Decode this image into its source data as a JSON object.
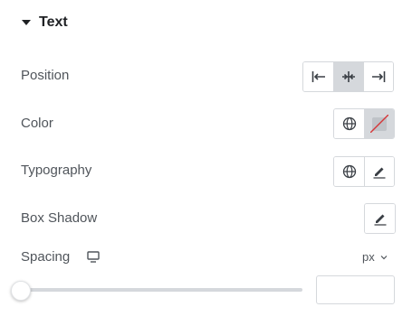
{
  "section": {
    "title": "Text",
    "expanded": true
  },
  "position": {
    "label": "Position",
    "options": [
      "align-start",
      "align-center",
      "align-end"
    ],
    "selected": "align-center"
  },
  "color": {
    "label": "Color",
    "value": "none"
  },
  "typography": {
    "label": "Typography"
  },
  "box_shadow": {
    "label": "Box Shadow"
  },
  "spacing": {
    "label": "Spacing",
    "unit": "px",
    "slider_value": 0,
    "input_value": ""
  },
  "colors": {
    "active_bg": "#d5d8dc",
    "border": "#d5d8dc",
    "text": "#50555b",
    "title": "#1f2124",
    "clear_line": "#d63638"
  }
}
